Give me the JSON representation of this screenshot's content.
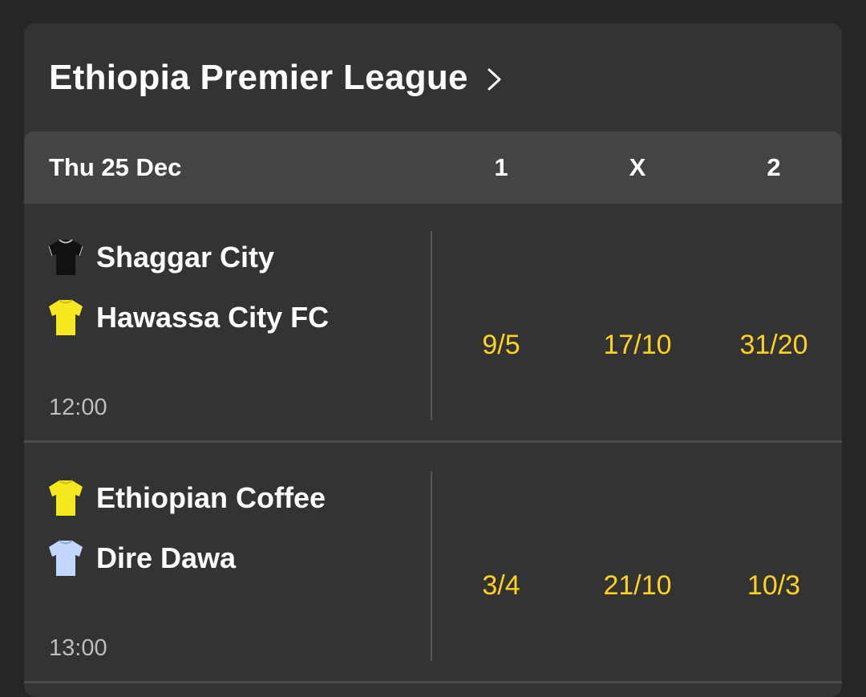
{
  "league": {
    "title": "Ethiopia Premier League",
    "chevron_icon": "chevron-right-icon"
  },
  "date_header": {
    "date": "Thu 25 Dec",
    "columns": [
      "1",
      "X",
      "2"
    ]
  },
  "colors": {
    "background": "#262626",
    "card": "#333333",
    "header_row": "#444444",
    "odds": "#ffd21f",
    "text": "#ffffff",
    "muted_text": "#bdbdbd"
  },
  "events": [
    {
      "home": {
        "name": "Shaggar City",
        "shirt_icon": "black-shirt-icon",
        "shirt_color": "#111111"
      },
      "away": {
        "name": "Hawassa City FC",
        "shirt_icon": "yellow-shirt-icon",
        "shirt_color": "#f5e81e"
      },
      "time": "12:00",
      "odds": [
        "9/5",
        "17/10",
        "31/20"
      ]
    },
    {
      "home": {
        "name": "Ethiopian Coffee",
        "shirt_icon": "yellow-shirt-icon",
        "shirt_color": "#f5e81e"
      },
      "away": {
        "name": "Dire Dawa",
        "shirt_icon": "light-blue-shirt-icon",
        "shirt_color": "#c2d8ff"
      },
      "time": "13:00",
      "odds": [
        "3/4",
        "21/10",
        "10/3"
      ]
    }
  ]
}
